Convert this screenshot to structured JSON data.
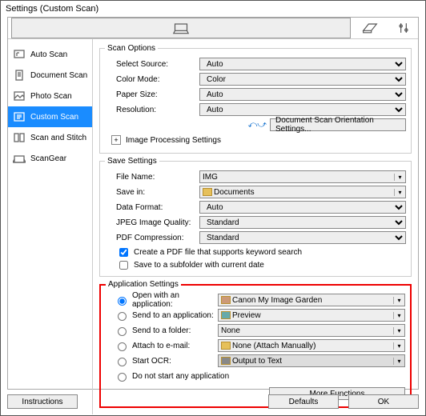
{
  "window": {
    "title": "Settings (Custom Scan)"
  },
  "sidebar": {
    "items": [
      {
        "label": "Auto Scan"
      },
      {
        "label": "Document Scan"
      },
      {
        "label": "Photo Scan"
      },
      {
        "label": "Custom Scan"
      },
      {
        "label": "Scan and Stitch"
      },
      {
        "label": "ScanGear"
      }
    ]
  },
  "scan_options": {
    "legend": "Scan Options",
    "select_source": {
      "label": "Select Source:",
      "value": "Auto"
    },
    "color_mode": {
      "label": "Color Mode:",
      "value": "Color"
    },
    "paper_size": {
      "label": "Paper Size:",
      "value": "Auto"
    },
    "resolution": {
      "label": "Resolution:",
      "value": "Auto"
    },
    "orientation_btn": "Document Scan Orientation Settings...",
    "img_proc": "Image Processing Settings"
  },
  "save_settings": {
    "legend": "Save Settings",
    "file_name": {
      "label": "File Name:",
      "value": "IMG"
    },
    "save_in": {
      "label": "Save in:",
      "value": "Documents"
    },
    "data_format": {
      "label": "Data Format:",
      "value": "Auto"
    },
    "jpeg_quality": {
      "label": "JPEG Image Quality:",
      "value": "Standard"
    },
    "pdf_compression": {
      "label": "PDF Compression:",
      "value": "Standard"
    },
    "chk_keyword": "Create a PDF file that supports keyword search",
    "chk_subfolder": "Save to a subfolder with current date"
  },
  "app_settings": {
    "legend": "Application Settings",
    "open_app": {
      "label": "Open with an application:",
      "value": "Canon My Image Garden"
    },
    "send_app": {
      "label": "Send to an application:",
      "value": "Preview"
    },
    "send_folder": {
      "label": "Send to a folder:",
      "value": "None"
    },
    "attach_email": {
      "label": "Attach to e-mail:",
      "value": "None (Attach Manually)"
    },
    "start_ocr": {
      "label": "Start OCR:",
      "value": "Output to Text"
    },
    "no_start": "Do not start any application",
    "more_functions": "More Functions"
  },
  "footer": {
    "instructions": "Instructions",
    "defaults": "Defaults",
    "ok": "OK"
  }
}
